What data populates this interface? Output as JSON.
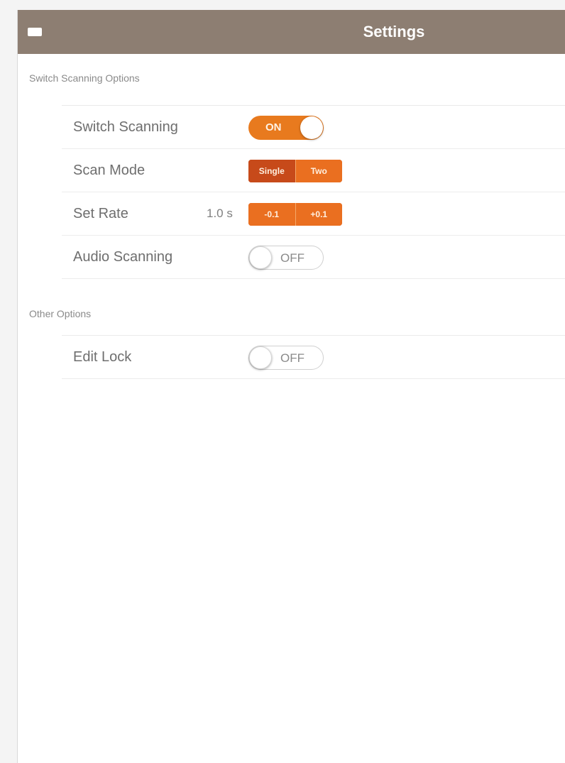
{
  "header": {
    "title": "Settings",
    "back_icon": "back-icon"
  },
  "sections": [
    {
      "title": "Switch Scanning Options",
      "rows": [
        {
          "label": "Switch Scanning",
          "control": "toggle",
          "state": "ON"
        },
        {
          "label": "Scan Mode",
          "control": "segmented",
          "options": [
            "Single",
            "Two"
          ],
          "selected": "Single"
        },
        {
          "label": "Set Rate",
          "control": "stepper",
          "value": "1.0 s",
          "decrement": "-0.1",
          "increment": "+0.1"
        },
        {
          "label": "Audio Scanning",
          "control": "toggle",
          "state": "OFF"
        }
      ]
    },
    {
      "title": "Other Options",
      "rows": [
        {
          "label": "Edit Lock",
          "control": "toggle",
          "state": "OFF"
        }
      ]
    }
  ],
  "colors": {
    "titlebar": "#8d7e72",
    "accent": "#e87a1e",
    "accent_dark": "#c74a1a",
    "background": "#ffffff"
  }
}
